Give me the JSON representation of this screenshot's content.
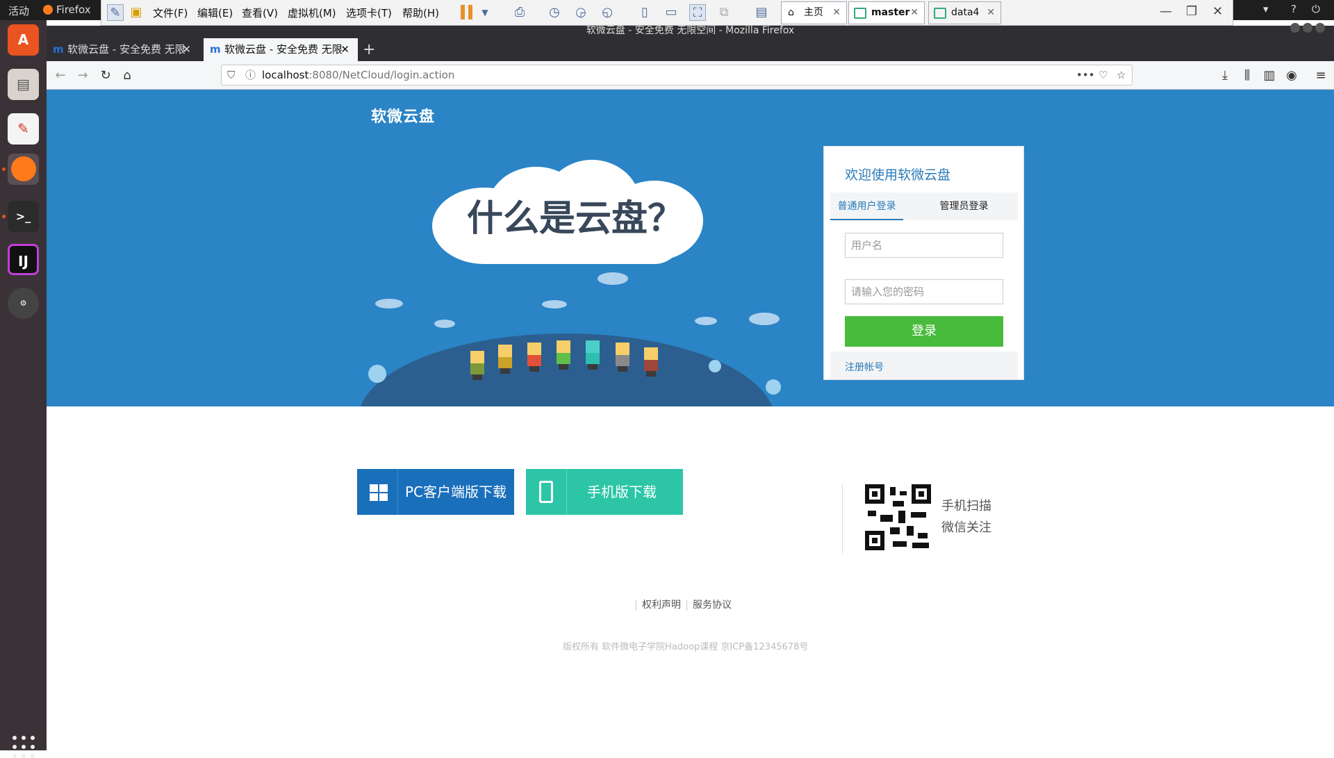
{
  "system": {
    "activities": "活动",
    "app_name": "Firefox",
    "window_title": "软微云盘 - 安全免费 无限空间 - Mozilla Firefox"
  },
  "vmware": {
    "menus": [
      "文件(F)",
      "编辑(E)",
      "查看(V)",
      "虚拟机(M)",
      "选项卡(T)",
      "帮助(H)"
    ],
    "tabs": [
      {
        "label": "主页",
        "icon": "home-icon"
      },
      {
        "label": "master",
        "icon": "vm-icon",
        "active": true
      },
      {
        "label": "data4",
        "icon": "vm-icon"
      }
    ]
  },
  "browser": {
    "tabs": [
      {
        "label": "软微云盘 - 安全免费 无限",
        "active": false
      },
      {
        "label": "软微云盘 - 安全免费 无限",
        "active": true
      }
    ],
    "url_host": "localhost",
    "url_path": ":8080/NetCloud/login.action"
  },
  "page": {
    "logo": "软微云盘",
    "cloud_heading": "什么是云盘？",
    "login": {
      "title": "欢迎使用软微云盘",
      "tab_user": "普通用户登录",
      "tab_admin": "管理员登录",
      "username_placeholder": "用户名",
      "password_placeholder": "请输入您的密码",
      "submit": "登录",
      "register": "注册帐号"
    },
    "downloads": {
      "pc": "PC客户端版下载",
      "mobile": "手机版下载"
    },
    "qr": {
      "line1": "手机扫描",
      "line2": "微信关注"
    },
    "footer": {
      "rights": "权利声明",
      "terms": "服务协议",
      "copyright": "版权所有 软件微电子学院Hadoop课程 京ICP备12345678号"
    }
  },
  "colors": {
    "hero_bg": "#2a84c6",
    "login_button": "#48bb3c",
    "pc_download": "#1a6fba",
    "mobile_download": "#2cc6a7"
  }
}
